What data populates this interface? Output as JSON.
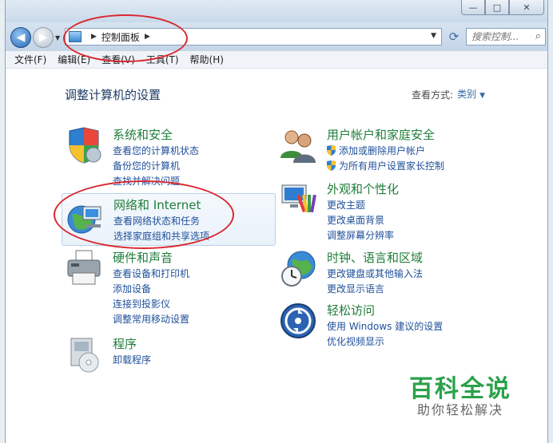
{
  "window": {
    "title_buttons": {
      "minimize": "—",
      "maximize": "□",
      "close": "✕"
    }
  },
  "nav": {
    "back_icon": "back-arrow-icon",
    "forward_icon": "forward-arrow-icon",
    "breadcrumb": "控制面板",
    "search_placeholder": "搜索控制..."
  },
  "menu": {
    "items": [
      "文件(F)",
      "编辑(E)",
      "查看(V)",
      "工具(T)",
      "帮助(H)"
    ]
  },
  "content": {
    "heading": "调整计算机的设置",
    "view_by_label": "查看方式:",
    "view_by_value": "类别"
  },
  "categories": [
    {
      "title": "系统和安全",
      "icon": "system-security-shield-icon",
      "links": [
        "查看您的计算机状态",
        "备份您的计算机",
        "查找并解决问题"
      ]
    },
    {
      "title": "网络和 Internet",
      "icon": "network-globe-icon",
      "links": [
        "查看网络状态和任务",
        "选择家庭组和共享选项"
      ]
    },
    {
      "title": "硬件和声音",
      "icon": "printer-icon",
      "links": [
        "查看设备和打印机",
        "添加设备",
        "连接到投影仪",
        "调整常用移动设置"
      ]
    },
    {
      "title": "程序",
      "icon": "programs-disc-icon",
      "links": [
        "卸载程序"
      ]
    },
    {
      "title": "用户帐户和家庭安全",
      "icon": "users-icon",
      "links": [
        "添加或删除用户帐户",
        "为所有用户设置家长控制"
      ]
    },
    {
      "title": "外观和个性化",
      "icon": "appearance-monitor-icon",
      "links": [
        "更改主题",
        "更改桌面背景",
        "调整屏幕分辨率"
      ]
    },
    {
      "title": "时钟、语言和区域",
      "icon": "clock-globe-icon",
      "links": [
        "更改键盘或其他输入法",
        "更改显示语言"
      ]
    },
    {
      "title": "轻松访问",
      "icon": "ease-of-access-icon",
      "links": [
        "使用 Windows 建议的设置",
        "优化视频显示"
      ]
    }
  ],
  "watermark": {
    "brand": "百科全说",
    "tagline": "助你轻松解决"
  },
  "colors": {
    "category_title": "#1f7e3a",
    "link": "#20509a",
    "annotation_red": "#d9282f",
    "watermark_green": "#2aa14a"
  }
}
